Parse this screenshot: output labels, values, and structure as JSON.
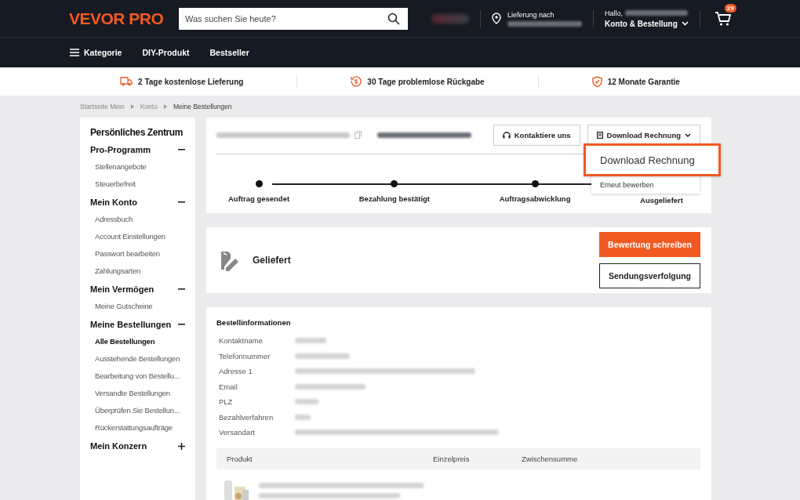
{
  "header": {
    "logo": "VEVOR PRO",
    "search": {
      "placeholder": "Was suchen Sie heute?"
    },
    "delivery_label": "Lieferung nach",
    "greeting": "Hallo,",
    "account_menu": "Konto & Bestellung",
    "cart_count": "29"
  },
  "nav": {
    "items": [
      "Kategorie",
      "DIY-Produkt",
      "Bestseller"
    ]
  },
  "benefits": [
    {
      "kind": "truck",
      "text": "2 Tage kostenlose Lieferung"
    },
    {
      "kind": "return",
      "text": "30 Tage problemlose Rückgabe"
    },
    {
      "kind": "shield",
      "text": "12 Monate Garantie"
    }
  ],
  "breadcrumb": [
    {
      "label": "Startseite Mein",
      "current": false
    },
    {
      "label": "Konto",
      "current": false
    },
    {
      "label": "Meine Bestellungen",
      "current": true
    }
  ],
  "sidebar": {
    "title": "Persönliches Zentrum",
    "sections": [
      {
        "label": "Pro-Programm",
        "expanded": true,
        "items": [
          {
            "label": "Stellenangebote",
            "selected": false
          },
          {
            "label": "Steuerbefreit",
            "selected": false
          }
        ]
      },
      {
        "label": "Mein Konto",
        "expanded": true,
        "items": [
          {
            "label": "Adressbuch",
            "selected": false
          },
          {
            "label": "Account Einstellungen",
            "selected": false
          },
          {
            "label": "Passwort bearbeiten",
            "selected": false
          },
          {
            "label": "Zahlungsarten",
            "selected": false
          }
        ]
      },
      {
        "label": "Mein Vermögen",
        "expanded": true,
        "items": [
          {
            "label": "Meine Gutscheine",
            "selected": false
          }
        ]
      },
      {
        "label": "Meine Bestellungen",
        "expanded": true,
        "items": [
          {
            "label": "Alle Bestellungen",
            "selected": true
          },
          {
            "label": "Ausstehende Bestellungen",
            "selected": false
          },
          {
            "label": "Bearbeitung von Bestellu...",
            "selected": false
          },
          {
            "label": "Versandte Bestellungen",
            "selected": false
          },
          {
            "label": "Überprüfen Sie Bestellun...",
            "selected": false
          },
          {
            "label": "Rückerstattungsaufträge",
            "selected": false
          }
        ]
      },
      {
        "label": "Mein Konzern",
        "expanded": false
      }
    ]
  },
  "order": {
    "contact_button": "Kontaktiere uns",
    "invoice_button": "Download Rechnung",
    "invoice_menu": [
      {
        "label": "Download Rechnung",
        "selected": true
      },
      {
        "label": "Erneut bewerben",
        "selected": false
      }
    ],
    "steps": [
      "Auftrag gesendet",
      "Bezahlung bestätigt",
      "Auftragsabwicklung",
      "Ausgeliefert"
    ]
  },
  "status": {
    "label": "Geliefert",
    "review_button": "Bewertung schreiben",
    "tracking_button": "Sendungsverfolgung"
  },
  "info": {
    "title": "Bestellinformationen",
    "fields": [
      "Kontaktname",
      "Telefonnummer",
      "Adresse 1",
      "Email",
      "PLZ",
      "Bezahlverfahren",
      "Versandart"
    ],
    "table": {
      "columns": [
        "Produkt",
        "Einzelpreis",
        "Zwischensumme"
      ]
    }
  }
}
